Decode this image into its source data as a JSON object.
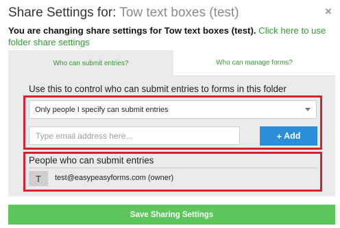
{
  "header": {
    "title_prefix": "Share Settings for:",
    "title_name": "Tow text boxes (test)",
    "close_glyph": "×"
  },
  "notice": {
    "text": "You are changing share settings for Tow text boxes (test).",
    "link": "Click here to use folder share settings"
  },
  "tabs": {
    "submit": "Who can submit entries?",
    "manage": "Who can manage forms?"
  },
  "submit_section": {
    "label": "Use this to control who can submit entries to forms in this folder",
    "select_value": "Only people I specify can submit entries",
    "email_placeholder": "Type email address here...",
    "add_label": "Add",
    "add_icon": "+"
  },
  "people": {
    "title": "People who can submit entries",
    "items": [
      {
        "initial": "T",
        "email": "test@easypeasyforms.com (owner)"
      }
    ]
  },
  "footer": {
    "save_label": "Save Sharing Settings"
  },
  "colors": {
    "link_green": "#2e9a2e",
    "save_green": "#5cc65c",
    "add_blue": "#2a8fd8",
    "highlight_red": "#d2222d"
  }
}
